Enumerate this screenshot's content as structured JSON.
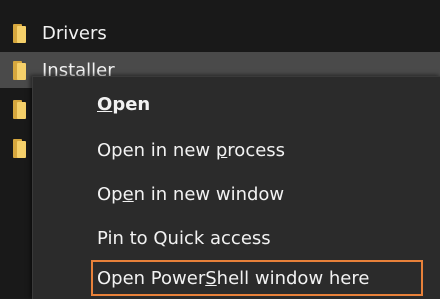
{
  "explorer": {
    "files": [
      {
        "name": "Drivers",
        "selected": false
      },
      {
        "name": "Installer",
        "selected": true
      }
    ]
  },
  "context_menu": {
    "items": [
      {
        "label_pre": "",
        "label_accel": "O",
        "label_post": "pen",
        "bold": true
      },
      {
        "label_pre": "Open in new ",
        "label_accel": "p",
        "label_post": "rocess",
        "bold": false
      },
      {
        "label_pre": "Op",
        "label_accel": "e",
        "label_post": "n in new window",
        "bold": false
      },
      {
        "label_pre": "Pin to Quick access",
        "label_accel": "",
        "label_post": "",
        "bold": false
      },
      {
        "label_pre": "Open Power",
        "label_accel": "S",
        "label_post": "hell window here",
        "bold": false,
        "highlighted": true
      }
    ],
    "highlight_color": "#e8813a"
  }
}
